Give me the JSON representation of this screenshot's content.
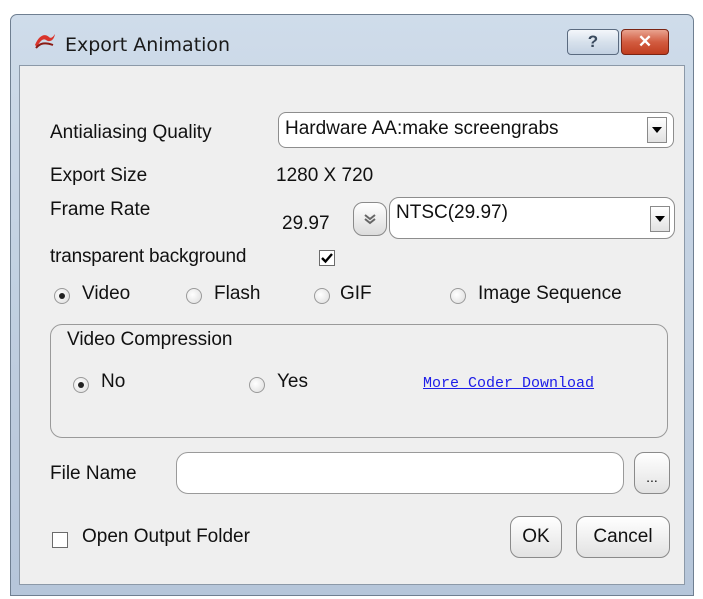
{
  "window": {
    "title": "Export Animation",
    "help_label": "?",
    "close_label": "✕"
  },
  "form": {
    "antialiasing_label": "Antialiasing Quality",
    "antialiasing_value": "Hardware AA:make screengrabs",
    "export_size_label": "Export Size",
    "export_size_value": "1280 X 720",
    "frame_rate_label": "Frame Rate",
    "frame_rate_value": "29.97",
    "frame_rate_preset": "NTSC(29.97)",
    "transparent_label": "transparent background",
    "transparent_checked": true,
    "formats": [
      {
        "label": "Video",
        "selected": true
      },
      {
        "label": "Flash",
        "selected": false
      },
      {
        "label": "GIF",
        "selected": false
      },
      {
        "label": "Image Sequence",
        "selected": false
      }
    ],
    "compression": {
      "title": "Video Compression",
      "no_label": "No",
      "yes_label": "Yes",
      "selected": "No",
      "coder_link": "More Coder Download"
    },
    "file_name_label": "File Name",
    "file_name_value": "",
    "browse_label": "...",
    "open_folder_label": "Open Output Folder",
    "open_folder_checked": false,
    "ok_label": "OK",
    "cancel_label": "Cancel"
  },
  "icons": {
    "app": "red-wave-logo-icon",
    "spinner": "double-chevron-icon",
    "dropdown": "triangle-down-icon"
  }
}
